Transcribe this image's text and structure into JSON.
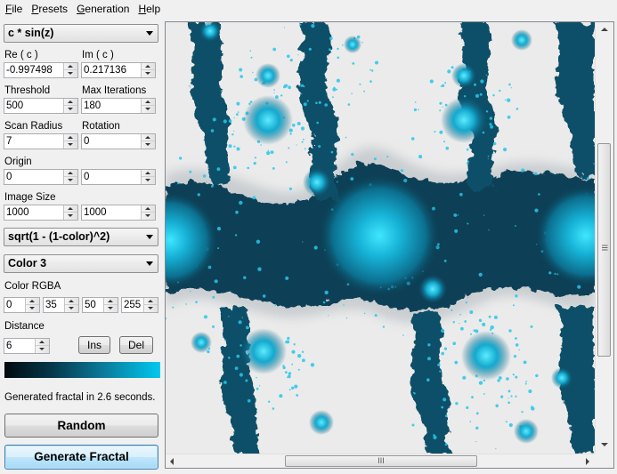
{
  "menu": [
    "File",
    "Presets",
    "Generation",
    "Help"
  ],
  "formula_select": "c * sin(z)",
  "re_c": {
    "label": "Re ( c )",
    "value": "-0.997498"
  },
  "im_c": {
    "label": "Im ( c )",
    "value": "0.217136"
  },
  "threshold": {
    "label": "Threshold",
    "value": "500"
  },
  "max_iterations": {
    "label": "Max Iterations",
    "value": "180"
  },
  "scan_radius": {
    "label": "Scan Radius",
    "value": "7"
  },
  "rotation": {
    "label": "Rotation",
    "value": "0"
  },
  "origin": {
    "label": "Origin",
    "x": "0",
    "y": "0"
  },
  "image_size": {
    "label": "Image Size",
    "width": "1000",
    "height": "1000"
  },
  "color_function_select": "sqrt(1 - (1-color)^2)",
  "color_select": "Color 3",
  "color_rgba": {
    "label": "Color RGBA",
    "r": "0",
    "g": "35",
    "b": "50",
    "a": "255"
  },
  "distance": {
    "label": "Distance",
    "value": "6"
  },
  "buttons": {
    "ins": "Ins",
    "del": "Del",
    "random": "Random",
    "generate": "Generate Fractal"
  },
  "status": "Generated fractal in 2.6 seconds.",
  "scroll_grip": "III",
  "colors": {
    "fractal_dark": "#0b3a4d",
    "fractal_mid": "#0b84a6",
    "fractal_bright": "#21d4f7",
    "background": "#ebebeb"
  }
}
